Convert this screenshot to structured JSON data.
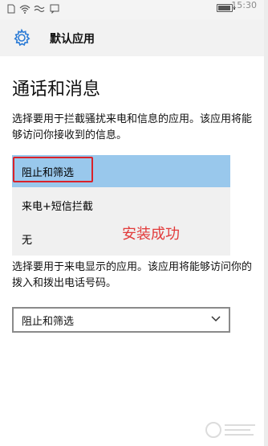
{
  "status_bar": {
    "time": "15:30",
    "icons": [
      "sim-icon",
      "wifi-icon",
      "notification-icon",
      "message-icon",
      "battery-icon"
    ],
    "battery_level": 0.9
  },
  "header": {
    "icon": "gear-icon",
    "title": "默认应用"
  },
  "page": {
    "title": "通话和消息",
    "description_1": "选择要用于拦截骚扰来电和信息的应用。该应用将能够访问你接收到的信息。",
    "list": {
      "items": [
        {
          "label": "阻止和筛选",
          "selected": true
        },
        {
          "label": "来电+短信拦截",
          "selected": false
        },
        {
          "label": "无",
          "selected": false
        }
      ]
    },
    "annotation": "安装成功",
    "description_2": "选择要用于来电显示的应用。该应用将能够访问你的拨入和拨出电话号码。",
    "dropdown": {
      "selected": "阻止和筛选"
    }
  },
  "colors": {
    "selected_item": "#99c8ec",
    "highlight_border": "#d9222a",
    "annotation": "#e23b3b"
  }
}
